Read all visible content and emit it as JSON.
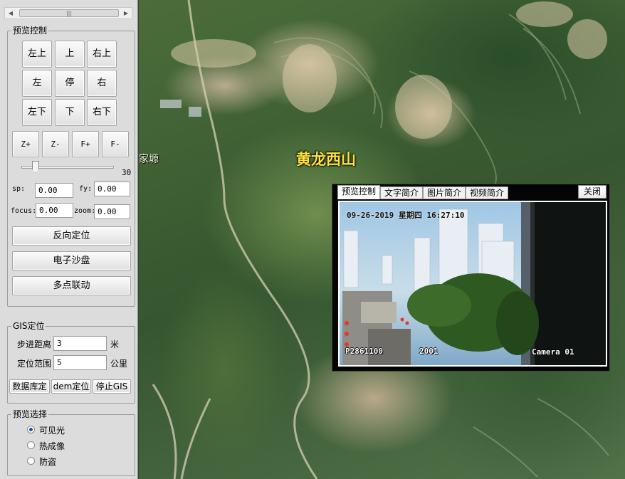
{
  "panel": {
    "scroll_grip": "|||",
    "preview_control": {
      "title": "预览控制",
      "dir_buttons": [
        "左上",
        "上",
        "右上",
        "左",
        "停",
        "右",
        "左下",
        "下",
        "右下"
      ],
      "zoom_focus_buttons": [
        "Z+",
        "Z-",
        "F+",
        "F-"
      ],
      "speed_slider": {
        "value": 30,
        "max": 255
      },
      "fields": {
        "sp": {
          "label": "sp:",
          "value": "0.00"
        },
        "fy": {
          "label": "fy:",
          "value": "0.00"
        },
        "focus": {
          "label": "focus:",
          "value": "0.00"
        },
        "zoom": {
          "label": "zoom:",
          "value": "0.00"
        }
      },
      "buttons": [
        "反向定位",
        "电子沙盘",
        "多点联动"
      ]
    },
    "gis": {
      "title": "GIS定位",
      "step_label": "步进距离",
      "step_value": "3",
      "step_unit": "米",
      "range_label": "定位范围",
      "range_value": "5",
      "range_unit": "公里",
      "buttons": [
        "数据库定",
        "dem定位",
        "停止GIS"
      ]
    },
    "preview_select": {
      "title": "预览选择",
      "options": [
        "可见光",
        "热成像",
        "防盗"
      ],
      "selected": 0
    }
  },
  "map": {
    "place_label": "黄龙西山",
    "partial_label": "家塬"
  },
  "popup": {
    "tabs": [
      "预览控制",
      "文字简介",
      "图片简介",
      "视频简介"
    ],
    "active_tab": 0,
    "close_label": "关闭",
    "osd": {
      "datetime": "09-26-2019 星期四 16:27:10",
      "code": "P2861100",
      "number": "2001",
      "camera": "Camera 01"
    }
  },
  "colors": {
    "panel_bg": "#dcdcdc",
    "place_label": "#ffe23a",
    "radio_dot": "#1f4ea8"
  }
}
